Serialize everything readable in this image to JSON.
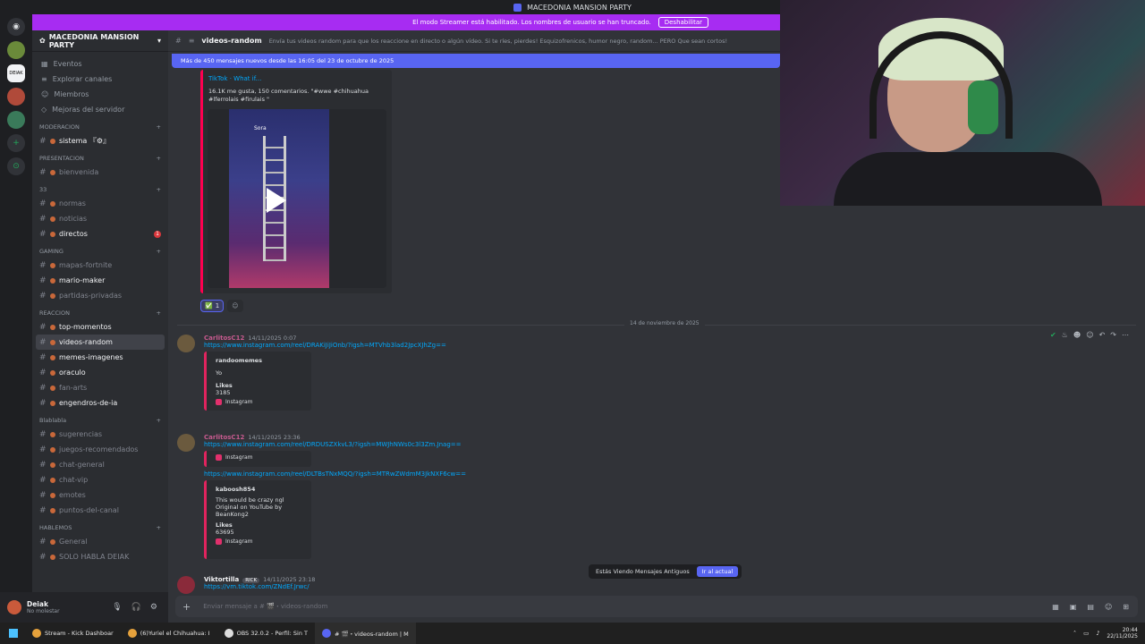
{
  "window": {
    "title": "MACEDONIA MANSION PARTY"
  },
  "streamer_banner": {
    "text": "El modo Streamer está habilitado. Los nombres de usuario se han truncado.",
    "button": "Deshabilitar"
  },
  "guilds": [
    "discord-home",
    "server-1",
    "server-deiak",
    "server-3",
    "server-4",
    "add-server",
    "discover"
  ],
  "sidebar": {
    "server_name": "MACEDONIA MANSION PARTY",
    "nav": [
      "Eventos",
      "Explorar canales",
      "Miembros",
      "Mejoras del servidor"
    ],
    "sections": [
      {
        "category": "MODERACION",
        "channels": [
          {
            "name": "sistema 『⚙』",
            "unread": true
          }
        ]
      },
      {
        "category": "PRESENTACION",
        "channels": [
          {
            "name": "bienvenida",
            "unread": false
          }
        ]
      },
      {
        "category": "33",
        "channels": [
          {
            "name": "normas",
            "unread": false
          },
          {
            "name": "noticias",
            "unread": false
          },
          {
            "name": "directos",
            "unread": true,
            "badge": "1"
          }
        ]
      },
      {
        "category": "GAMING",
        "channels": [
          {
            "name": "mapas-fortnite",
            "unread": false
          },
          {
            "name": "mario-maker",
            "unread": true
          },
          {
            "name": "partidas-privadas",
            "unread": false
          }
        ]
      },
      {
        "category": "REACCION",
        "channels": [
          {
            "name": "top-momentos",
            "unread": true
          },
          {
            "name": "videos-random",
            "unread": true,
            "active": true
          },
          {
            "name": "memes-imagenes",
            "unread": true
          },
          {
            "name": "oraculo",
            "unread": true
          },
          {
            "name": "fan-arts",
            "unread": false
          },
          {
            "name": "engendros-de-ia",
            "unread": true
          }
        ]
      },
      {
        "category": "Blablabla",
        "channels": [
          {
            "name": "sugerencias",
            "unread": false
          },
          {
            "name": "juegos-recomendados",
            "unread": false
          },
          {
            "name": "chat-general",
            "unread": false
          },
          {
            "name": "chat-vip",
            "unread": false
          },
          {
            "name": "emotes",
            "unread": false
          },
          {
            "name": "puntos-del-canal",
            "unread": false
          }
        ]
      },
      {
        "category": "HABLEMOS",
        "channels": [
          {
            "name": "General",
            "unread": false
          },
          {
            "name": "SOLO HABLA DEIAK",
            "unread": false
          }
        ]
      }
    ]
  },
  "user": {
    "name": "Deiak",
    "status": "No molestar"
  },
  "channel": {
    "name": "videos-random",
    "topic": "Envía tus videos random para que los reaccione en directo o algún vídeo. Si te ríes, pierdes! Esquizofrenicos, humor negro, random... PERO Que sean cortos!",
    "new_messages": "Más de 450 mensajes nuevos desde las 16:05 del 23 de octubre de 2025"
  },
  "tiktok_embed": {
    "title": "TikTok · What if...",
    "desc": "16.1K me gusta, 150 comentarios. \"#wwe #chihuahua #lferrolais #firulais \"",
    "source": "Sora"
  },
  "reactions": [
    {
      "emoji": "✅",
      "count": "1"
    }
  ],
  "day_divider": "14 de noviembre de 2025",
  "messages": [
    {
      "author": "CarlitosC12",
      "time": "14/11/2025 0:07",
      "link": "https://www.instagram.com/reel/DRAKiJiJiOnb/?igsh=MTVhb3lad2JpcXJhZg==",
      "embed": {
        "user": "randoomemes",
        "text": "Yo",
        "likes_label": "Likes",
        "likes": "3185",
        "source": "Instagram"
      }
    },
    {
      "author": "CarlitosC12",
      "time": "14/11/2025 23:36",
      "link": "https://www.instagram.com/reel/DRDUSZXkvL3/?igsh=MWJhNWs0c3l3Zm.Jnag==",
      "embed_source": "Instagram",
      "link2": "https://www.instagram.com/reel/DLTBsTNxMQQ/?igsh=MTRwZWdmM3JkNXF6cw==",
      "embed2": {
        "user": "kaboosh854",
        "text": "This would be crazy ngl",
        "text2": "Original on YouTube by BeanKong2",
        "likes_label": "Likes",
        "likes": "63695",
        "source": "Instagram"
      }
    },
    {
      "author": "Viktortilla",
      "role": "RICK",
      "time": "14/11/2025 23:18",
      "link": "https://vm.tiktok.com/ZNdEf.Jrwc/"
    }
  ],
  "old_messages": {
    "text": "Estás Viendo Mensajes Antiguos",
    "button": "Ir al actual"
  },
  "composer": {
    "placeholder": "Enviar mensaje a # 🎬・videos-random"
  },
  "taskbar": {
    "items": [
      "Stream - Kick Dashboar",
      "(6)Yuriel el Chihuahua: I",
      "OBS 32.0.2 - Perfil: Sin T",
      "# 🎬・videos-random | M"
    ],
    "time": "20:44",
    "date": "22/11/2025"
  }
}
